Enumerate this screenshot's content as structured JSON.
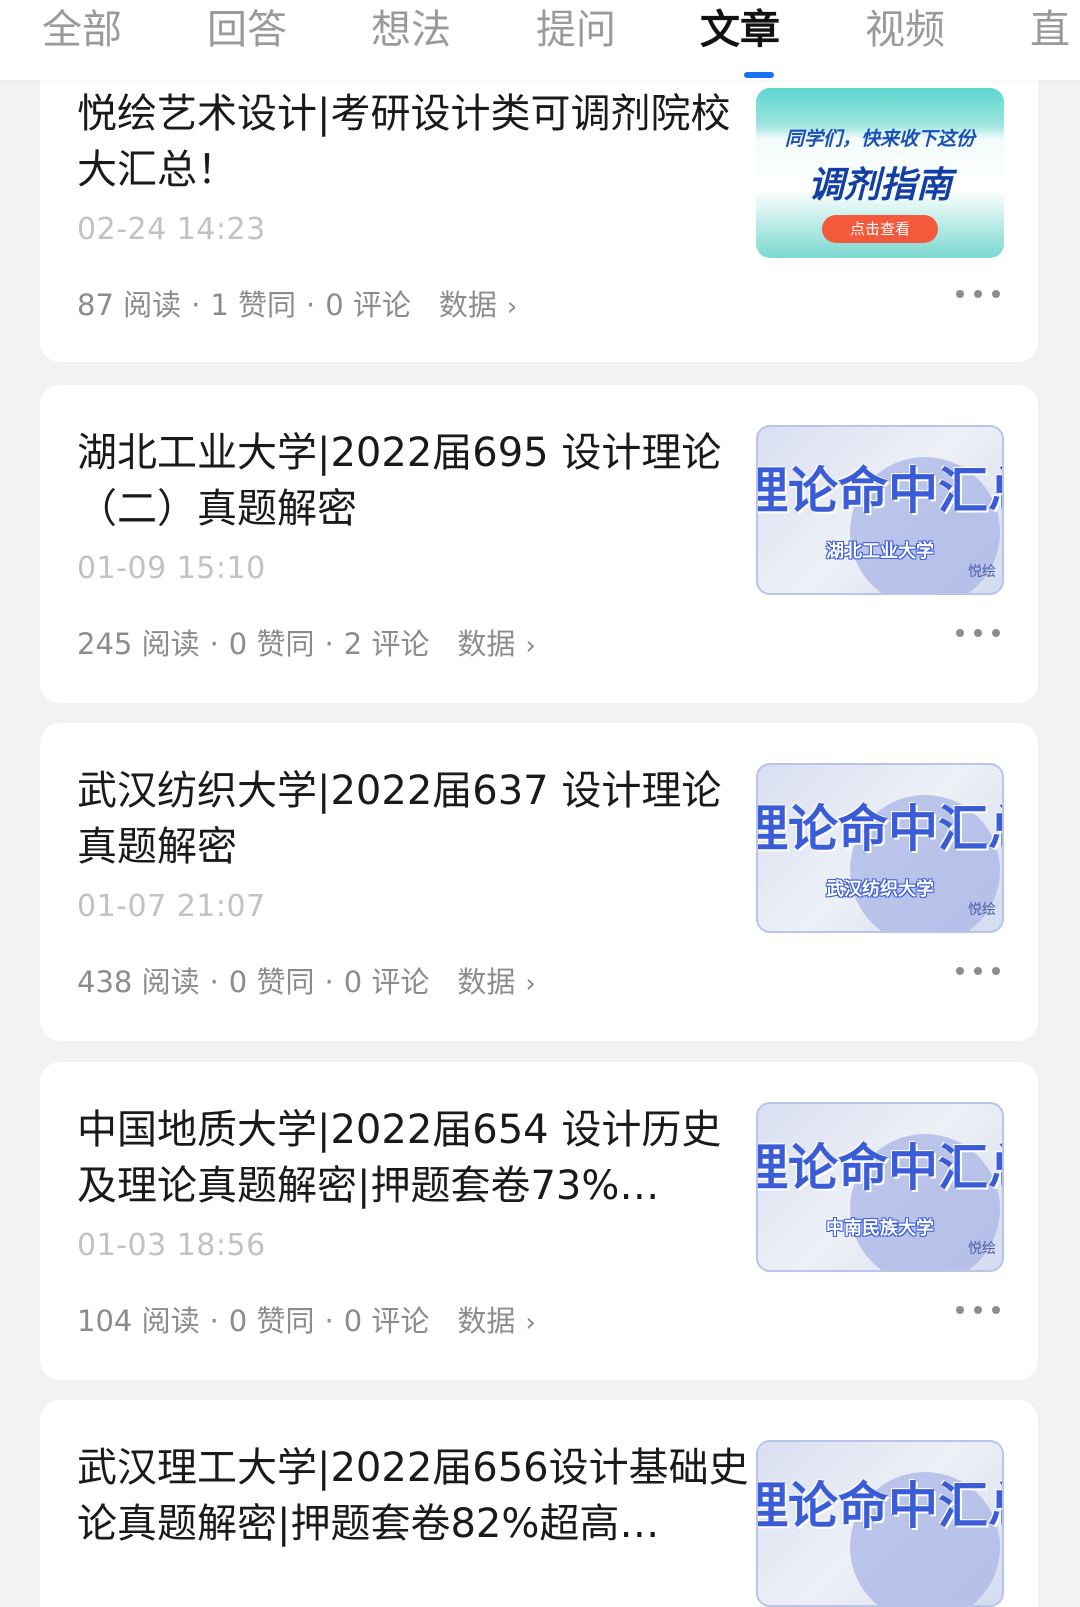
{
  "tabs": [
    {
      "label": "全部",
      "active": false
    },
    {
      "label": "回答",
      "active": false
    },
    {
      "label": "想法",
      "active": false
    },
    {
      "label": "提问",
      "active": false
    },
    {
      "label": "文章",
      "active": true
    },
    {
      "label": "视频",
      "active": false
    },
    {
      "label": "直",
      "active": false
    }
  ],
  "colors": {
    "accent": "#1772f6",
    "background": "#f2f2f4",
    "card": "#ffffff",
    "title_text": "#1a1a1a",
    "meta_text": "#8c8c8c"
  },
  "articles": [
    {
      "title": "悦绘艺术设计|考研设计类可调剂院校大汇总！",
      "date": "02-24 14:23",
      "reads": "87 阅读",
      "likes": "1 赞同",
      "comments": "0 评论",
      "data_link": "数据",
      "thumbnail": {
        "style": "guide",
        "line1": "同学们，快来收下这份",
        "line2": "调剂指南",
        "button": "点击查看"
      }
    },
    {
      "title": "湖北工业大学|2022届695 设计理论（二）真题解密",
      "date": "01-09 15:10",
      "reads": "245 阅读",
      "likes": "0 赞同",
      "comments": "2 评论",
      "data_link": "数据",
      "thumbnail": {
        "style": "blue",
        "big": "理论命中汇总",
        "sub": "湖北工业大学",
        "brand": "悦绘"
      }
    },
    {
      "title": "武汉纺织大学|2022届637 设计理论真题解密",
      "date": "01-07 21:07",
      "reads": "438 阅读",
      "likes": "0 赞同",
      "comments": "0 评论",
      "data_link": "数据",
      "thumbnail": {
        "style": "blue",
        "big": "理论命中汇总",
        "sub": "武汉纺织大学",
        "brand": "悦绘"
      }
    },
    {
      "title": "中国地质大学|2022届654 设计历史及理论真题解密|押题套卷73%…",
      "date": "01-03 18:56",
      "reads": "104 阅读",
      "likes": "0 赞同",
      "comments": "0 评论",
      "data_link": "数据",
      "thumbnail": {
        "style": "blue",
        "big": "理论命中汇总",
        "sub": "中南民族大学",
        "brand": "悦绘"
      }
    },
    {
      "title": "武汉理工大学|2022届656设计基础史论真题解密|押题套卷82%超高…",
      "date": "",
      "reads": "",
      "likes": "",
      "comments": "",
      "data_link": "",
      "thumbnail": {
        "style": "blue",
        "big": "理论命中汇总",
        "sub": "",
        "brand": ""
      }
    }
  ]
}
